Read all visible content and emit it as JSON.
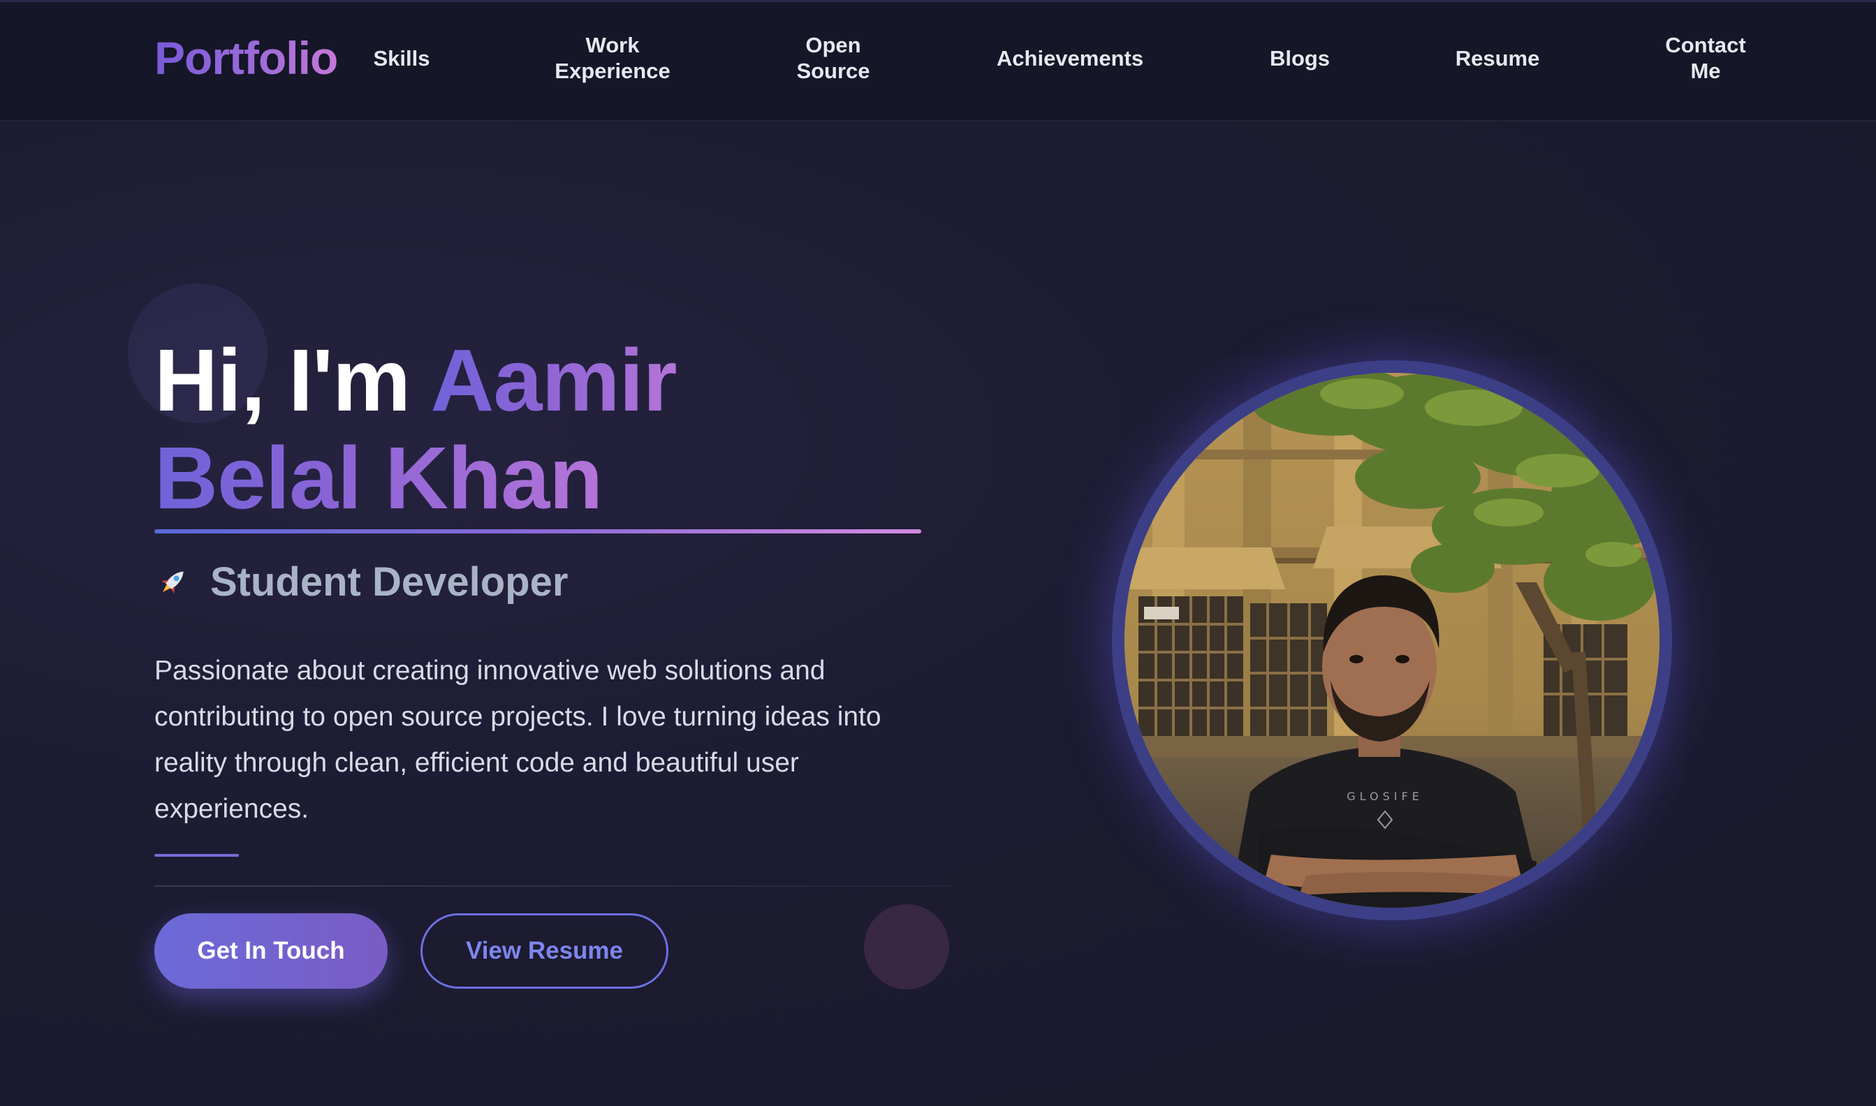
{
  "nav": {
    "brand": "Portfolio",
    "items": [
      {
        "label": "Skills"
      },
      {
        "label_line1": "Work",
        "label_line2": "Experience"
      },
      {
        "label_line1": "Open",
        "label_line2": "Source"
      },
      {
        "label": "Achievements"
      },
      {
        "label": "Blogs"
      },
      {
        "label": "Resume"
      },
      {
        "label_line1": "Contact",
        "label_line2": "Me"
      }
    ]
  },
  "hero": {
    "greeting": "Hi, I'm",
    "name_part1": "Aamir",
    "name_part2": "Belal Khan",
    "subtitle_icon": "rocket-icon",
    "subtitle": "Student Developer",
    "description": "Passionate about creating innovative web solutions and contributing to open source projects. I love turning ideas into reality through clean, efficient code and beautiful user experiences.",
    "primary_button": "Get In Touch",
    "secondary_button": "View Resume"
  },
  "profile": {
    "photo": "profile-photo",
    "shirt_text": "GLOSIFE"
  },
  "colors": {
    "background": "#1b1a2e",
    "navbar": "#151627",
    "accent_blue": "#6b6ad9",
    "accent_purple": "#b474d8",
    "text_primary": "#ffffff",
    "text_muted": "#a9b3c7"
  }
}
